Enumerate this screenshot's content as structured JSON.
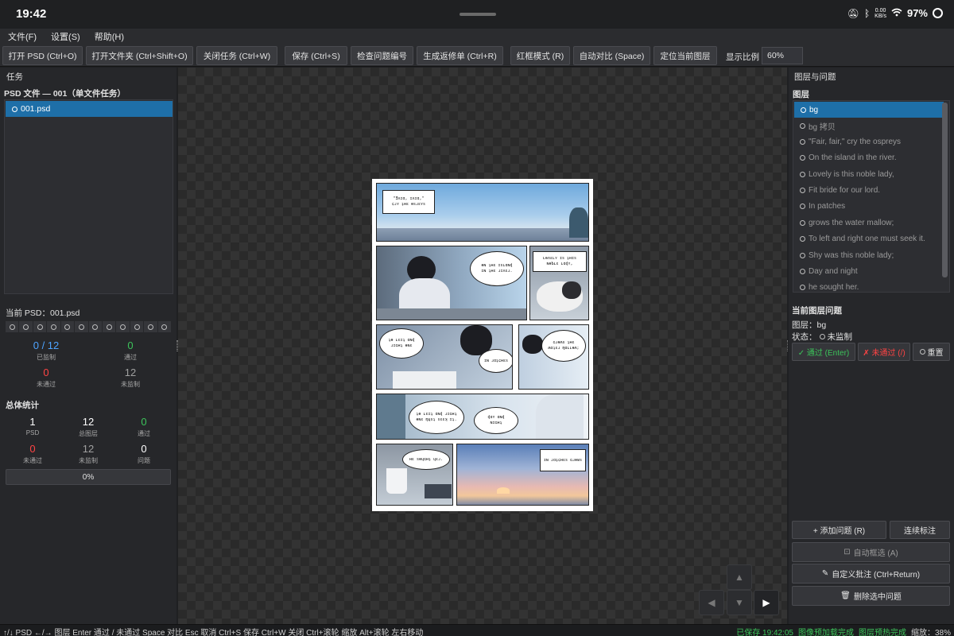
{
  "system": {
    "time": "19:42",
    "speed_value": "0.00",
    "speed_unit": "KB/s",
    "battery": "97%"
  },
  "menu": [
    "文件(F)",
    "设置(S)",
    "帮助(H)"
  ],
  "toolbar": {
    "buttons": [
      "打开 PSD (Ctrl+O)",
      "打开文件夹 (Ctrl+Shift+O)",
      "关闭任务 (Ctrl+W)",
      "保存 (Ctrl+S)",
      "检查问题编号",
      "生成返修单 (Ctrl+R)",
      "红框模式 (R)",
      "自动对比 (Space)",
      "定位当前图层"
    ],
    "scale_label": "显示比例",
    "scale_value": "60%"
  },
  "left": {
    "title": "任务",
    "subtitle": "PSD 文件 — 001（单文件任务）",
    "task_item": "001.psd",
    "current_psd": "当前 PSD：001.psd",
    "current_stats": [
      {
        "value": "0 / 12",
        "label": "已监制",
        "color": "#4da3ff"
      },
      {
        "value": "0",
        "label": "通过",
        "color": "#3cc35a"
      },
      {
        "value": "0",
        "label": "未通过",
        "color": "#ff4444"
      },
      {
        "value": "12",
        "label": "未监制",
        "color": "#a0a0a0"
      }
    ],
    "total_title": "总体统计",
    "total_stats": [
      {
        "value": "1",
        "label": "PSD",
        "color": "#ffffff"
      },
      {
        "value": "12",
        "label": "总图层",
        "color": "#ffffff"
      },
      {
        "value": "0",
        "label": "通过",
        "color": "#3cc35a"
      },
      {
        "value": "0",
        "label": "未通过",
        "color": "#ff4444"
      },
      {
        "value": "12",
        "label": "未监制",
        "color": "#a0a0a0"
      },
      {
        "value": "0",
        "label": "问题",
        "color": "#ffffff"
      }
    ],
    "progress": "0%"
  },
  "right": {
    "title": "图层与问题",
    "layers_title": "图层",
    "layers": [
      "bg",
      "bg 拷贝",
      "\"Fair, fair,\" cry the ospreys",
      "On the island  in the river.",
      "Lovely is this  noble lady,",
      "Fit bride  for our lord.",
      "In patches",
      "grows the  water mallow;",
      "To left and right  one must seek it.",
      "Shy was  this noble lady;",
      "Day and night",
      "he sought her."
    ],
    "issue_title": "当前图层问题",
    "issue_layer": "图层：bg",
    "issue_status_label": "状态：",
    "issue_status": "未监制",
    "pass_btn": "✓ 通过 (Enter)",
    "fail_btn": "✗ 未通过 (/)",
    "reset_btn": "重置",
    "add_issue_btn": "+ 添加问题 (R)",
    "continuous_btn": "连续标注",
    "auto_select_btn": "自动框选 (A)",
    "custom_note_btn": "自定义批注 (Ctrl+Return)",
    "delete_btn": "删除选中问题"
  },
  "bottom": {
    "shortcuts": "↑/↓ PSD    ←/→ 图层    Enter 通过    / 未通过    Space 对比    Esc 取消    Ctrl+S 保存    Ctrl+W 关闭    Ctrl+滚轮 缩放    Alt+滚轮 左右移动",
    "saved": "已保存 19:42:05",
    "preload": "图像预加载完成",
    "layer_preload": "图层预热完成",
    "zoom": "缩放：38%"
  },
  "colors": {
    "accent": "#1e6fa8",
    "pass": "#3cc35a",
    "fail": "#ff4444"
  }
}
